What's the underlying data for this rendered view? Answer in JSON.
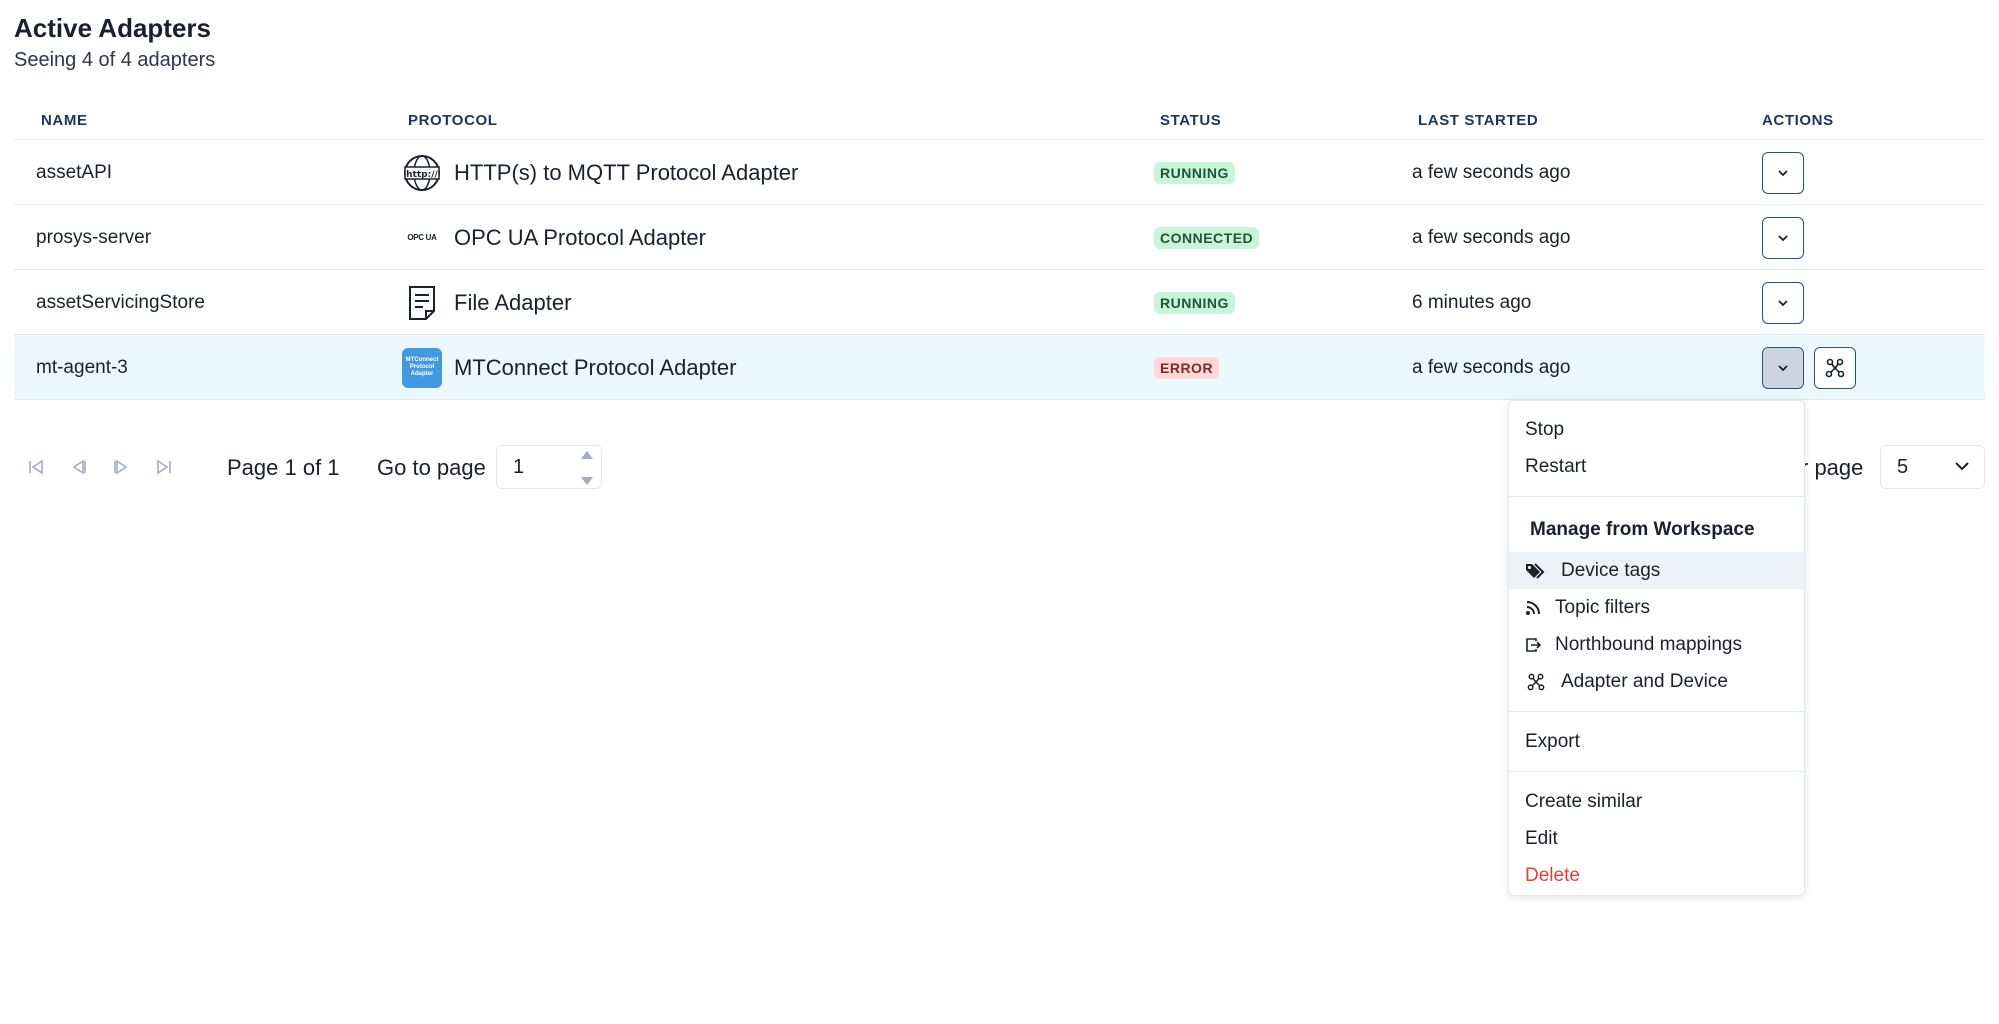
{
  "header": {
    "title": "Active Adapters",
    "subtitle": "Seeing 4 of 4 adapters"
  },
  "table": {
    "columns": [
      "NAME",
      "PROTOCOL",
      "STATUS",
      "LAST STARTED",
      "ACTIONS"
    ],
    "rows": [
      {
        "name": "assetAPI",
        "protocol": "HTTP(s) to MQTT Protocol Adapter",
        "protocol_icon": "http-icon",
        "status": "RUNNING",
        "status_color": "#c6f6d5",
        "last_started": "a few seconds ago"
      },
      {
        "name": "prosys-server",
        "protocol": "OPC UA Protocol Adapter",
        "protocol_icon": "opc-ua-icon",
        "protocol_icon_text": "OPC UA",
        "status": "CONNECTED",
        "status_color": "#c6f6d5",
        "last_started": "a few seconds ago"
      },
      {
        "name": "assetServicingStore",
        "protocol": "File Adapter",
        "protocol_icon": "file-icon",
        "status": "RUNNING",
        "status_color": "#c6f6d5",
        "last_started": "6 minutes ago"
      },
      {
        "name": "mt-agent-3",
        "protocol": "MTConnect Protocol Adapter",
        "protocol_icon": "mtconnect-icon",
        "protocol_icon_text": "MTConnect Protocol Adapter",
        "status": "ERROR",
        "status_color": "#fed7d7",
        "last_started": "a few seconds ago"
      }
    ]
  },
  "pagination": {
    "page_label": "Page 1 of 1",
    "go_to_label": "Go to page",
    "go_to_value": "1",
    "rows_per_page_label": "r page",
    "rows_per_page_value": "5"
  },
  "menu": {
    "items_top": [
      "Stop",
      "Restart"
    ],
    "group_title": "Manage from Workspace",
    "workspace_items": [
      {
        "label": "Device tags",
        "icon": "tags-icon"
      },
      {
        "label": "Topic filters",
        "icon": "rss-icon"
      },
      {
        "label": "Northbound mappings",
        "icon": "export-box-icon"
      },
      {
        "label": "Adapter and Device",
        "icon": "nodes-icon"
      }
    ],
    "export": "Export",
    "create_similar": "Create similar",
    "edit": "Edit",
    "delete": "Delete"
  },
  "colors": {
    "accent": "#2c5282",
    "highlight_row": "#ebf8ff",
    "danger": "#e53e3e"
  }
}
